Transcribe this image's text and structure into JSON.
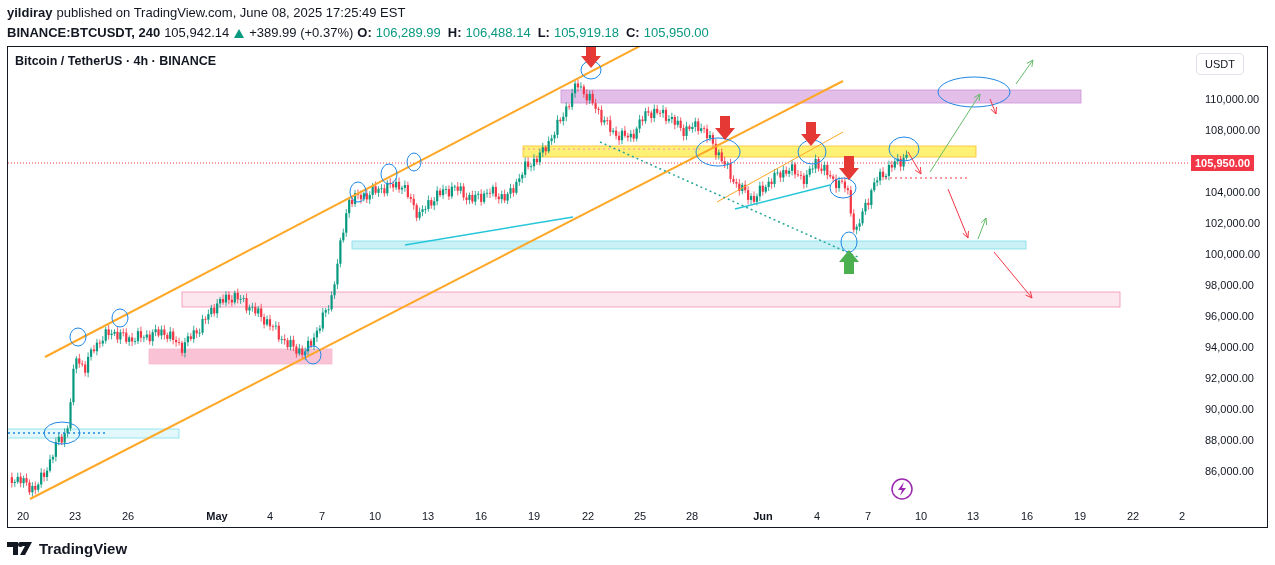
{
  "header": {
    "publisher": "yildiray",
    "published_text": "published on TradingView.com, June 08, 2025 17:25:49 EST"
  },
  "quote": {
    "symbol": "BINANCE:BTCUSDT, 240",
    "last": "105,942.14",
    "change_up": true,
    "change": "+389.99 (+0.37%)",
    "ohlc": [
      {
        "label": "O:",
        "value": "106,289.99"
      },
      {
        "label": "H:",
        "value": "106,488.14"
      },
      {
        "label": "L:",
        "value": "105,919.18"
      },
      {
        "label": "C:",
        "value": "105,950.00"
      }
    ]
  },
  "chart": {
    "title": "Bitcoin / TetherUS · 4h · BINANCE",
    "currency": "USDT",
    "current_price": "105,950.00",
    "price_ticks": [
      "110,000.00",
      "108,000.00",
      "104,000.00",
      "102,000.00",
      "100,000.00",
      "98,000.00",
      "96,000.00",
      "94,000.00",
      "92,000.00",
      "90,000.00",
      "88,000.00",
      "86,000.00"
    ],
    "time_ticks": [
      {
        "label": "20",
        "month": false
      },
      {
        "label": "23",
        "month": false
      },
      {
        "label": "26",
        "month": false
      },
      {
        "label": "May",
        "month": true
      },
      {
        "label": "4",
        "month": false
      },
      {
        "label": "7",
        "month": false
      },
      {
        "label": "10",
        "month": false
      },
      {
        "label": "13",
        "month": false
      },
      {
        "label": "16",
        "month": false
      },
      {
        "label": "19",
        "month": false
      },
      {
        "label": "22",
        "month": false
      },
      {
        "label": "25",
        "month": false
      },
      {
        "label": "28",
        "month": false
      },
      {
        "label": "Jun",
        "month": true
      },
      {
        "label": "4",
        "month": false
      },
      {
        "label": "7",
        "month": false
      },
      {
        "label": "10",
        "month": false
      },
      {
        "label": "13",
        "month": false
      },
      {
        "label": "16",
        "month": false
      },
      {
        "label": "19",
        "month": false
      },
      {
        "label": "22",
        "month": false
      },
      {
        "label": "2",
        "month": false
      }
    ]
  },
  "footer": {
    "brand": "TradingView"
  }
}
